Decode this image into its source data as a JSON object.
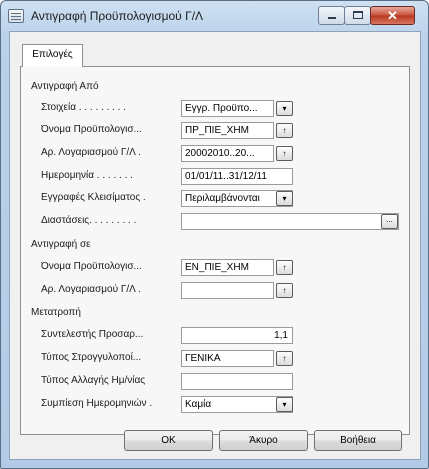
{
  "window": {
    "title": "Αντιγραφή Προϋπολογισμού Γ/Λ"
  },
  "titlebar": {
    "min_glyph": "",
    "max_glyph": "",
    "close_glyph": "✕"
  },
  "tabs": [
    {
      "label": "Επιλογές"
    }
  ],
  "sections": {
    "copy_from": "Αντιγραφή Από",
    "copy_to": "Αντιγραφή σε",
    "conversion": "Μετατροπή"
  },
  "copy_from": {
    "items": {
      "label": "Στοιχεία . . . . . . . . .",
      "value": "Εγγρ. Προϋπο...",
      "button": "▾"
    },
    "budget_name": {
      "label": "Όνομα Προϋπολογισ...",
      "value": "ΠΡ_ΠΙΕ_ΧΗΜ",
      "button": "↑"
    },
    "gl_account_no": {
      "label": "Αρ. Λογαριασμού Γ/Λ  .",
      "value": "20002010..20...",
      "button": "↑"
    },
    "date": {
      "label": "Ημερομηνία . . . . . . .",
      "value": "01/01/11..31/12/11"
    },
    "closing_entries": {
      "label": "Εγγραφές Κλεισίματος .",
      "value": "Περιλαμβάνονται",
      "button": "▾"
    },
    "dimensions": {
      "label": "Διαστάσεις. . . . . . . . .",
      "value": "",
      "button": "..."
    }
  },
  "copy_to": {
    "budget_name": {
      "label": "Όνομα Προϋπολογισ...",
      "value": "ΕΝ_ΠΙΕ_ΧΗΜ",
      "button": "↑"
    },
    "gl_account_no": {
      "label": "Αρ. Λογαριασμού Γ/Λ  .",
      "value": "",
      "button": "↑"
    }
  },
  "conversion": {
    "adjustment_factor": {
      "label": "Συντελεστής Προσαρ...",
      "value": "1,1"
    },
    "rounding_method": {
      "label": "Τύπος Στρογγυλοποί...",
      "value": "ΓΕΝΙΚΑ",
      "button": "↑"
    },
    "date_change_formula": {
      "label": "Τύπος Αλλαγής Ημ/νίας",
      "value": ""
    },
    "date_compression": {
      "label": "Συμπίεση Ημερομηνιών .",
      "value": "Καμία",
      "button": "▾"
    }
  },
  "buttons": {
    "ok": "OK",
    "cancel": "Άκυρο",
    "help": "Βοήθεια"
  },
  "colors": {
    "title_bar": "#b9d1ea",
    "close_button": "#c8503b",
    "client_bg": "#f0f0f0"
  }
}
